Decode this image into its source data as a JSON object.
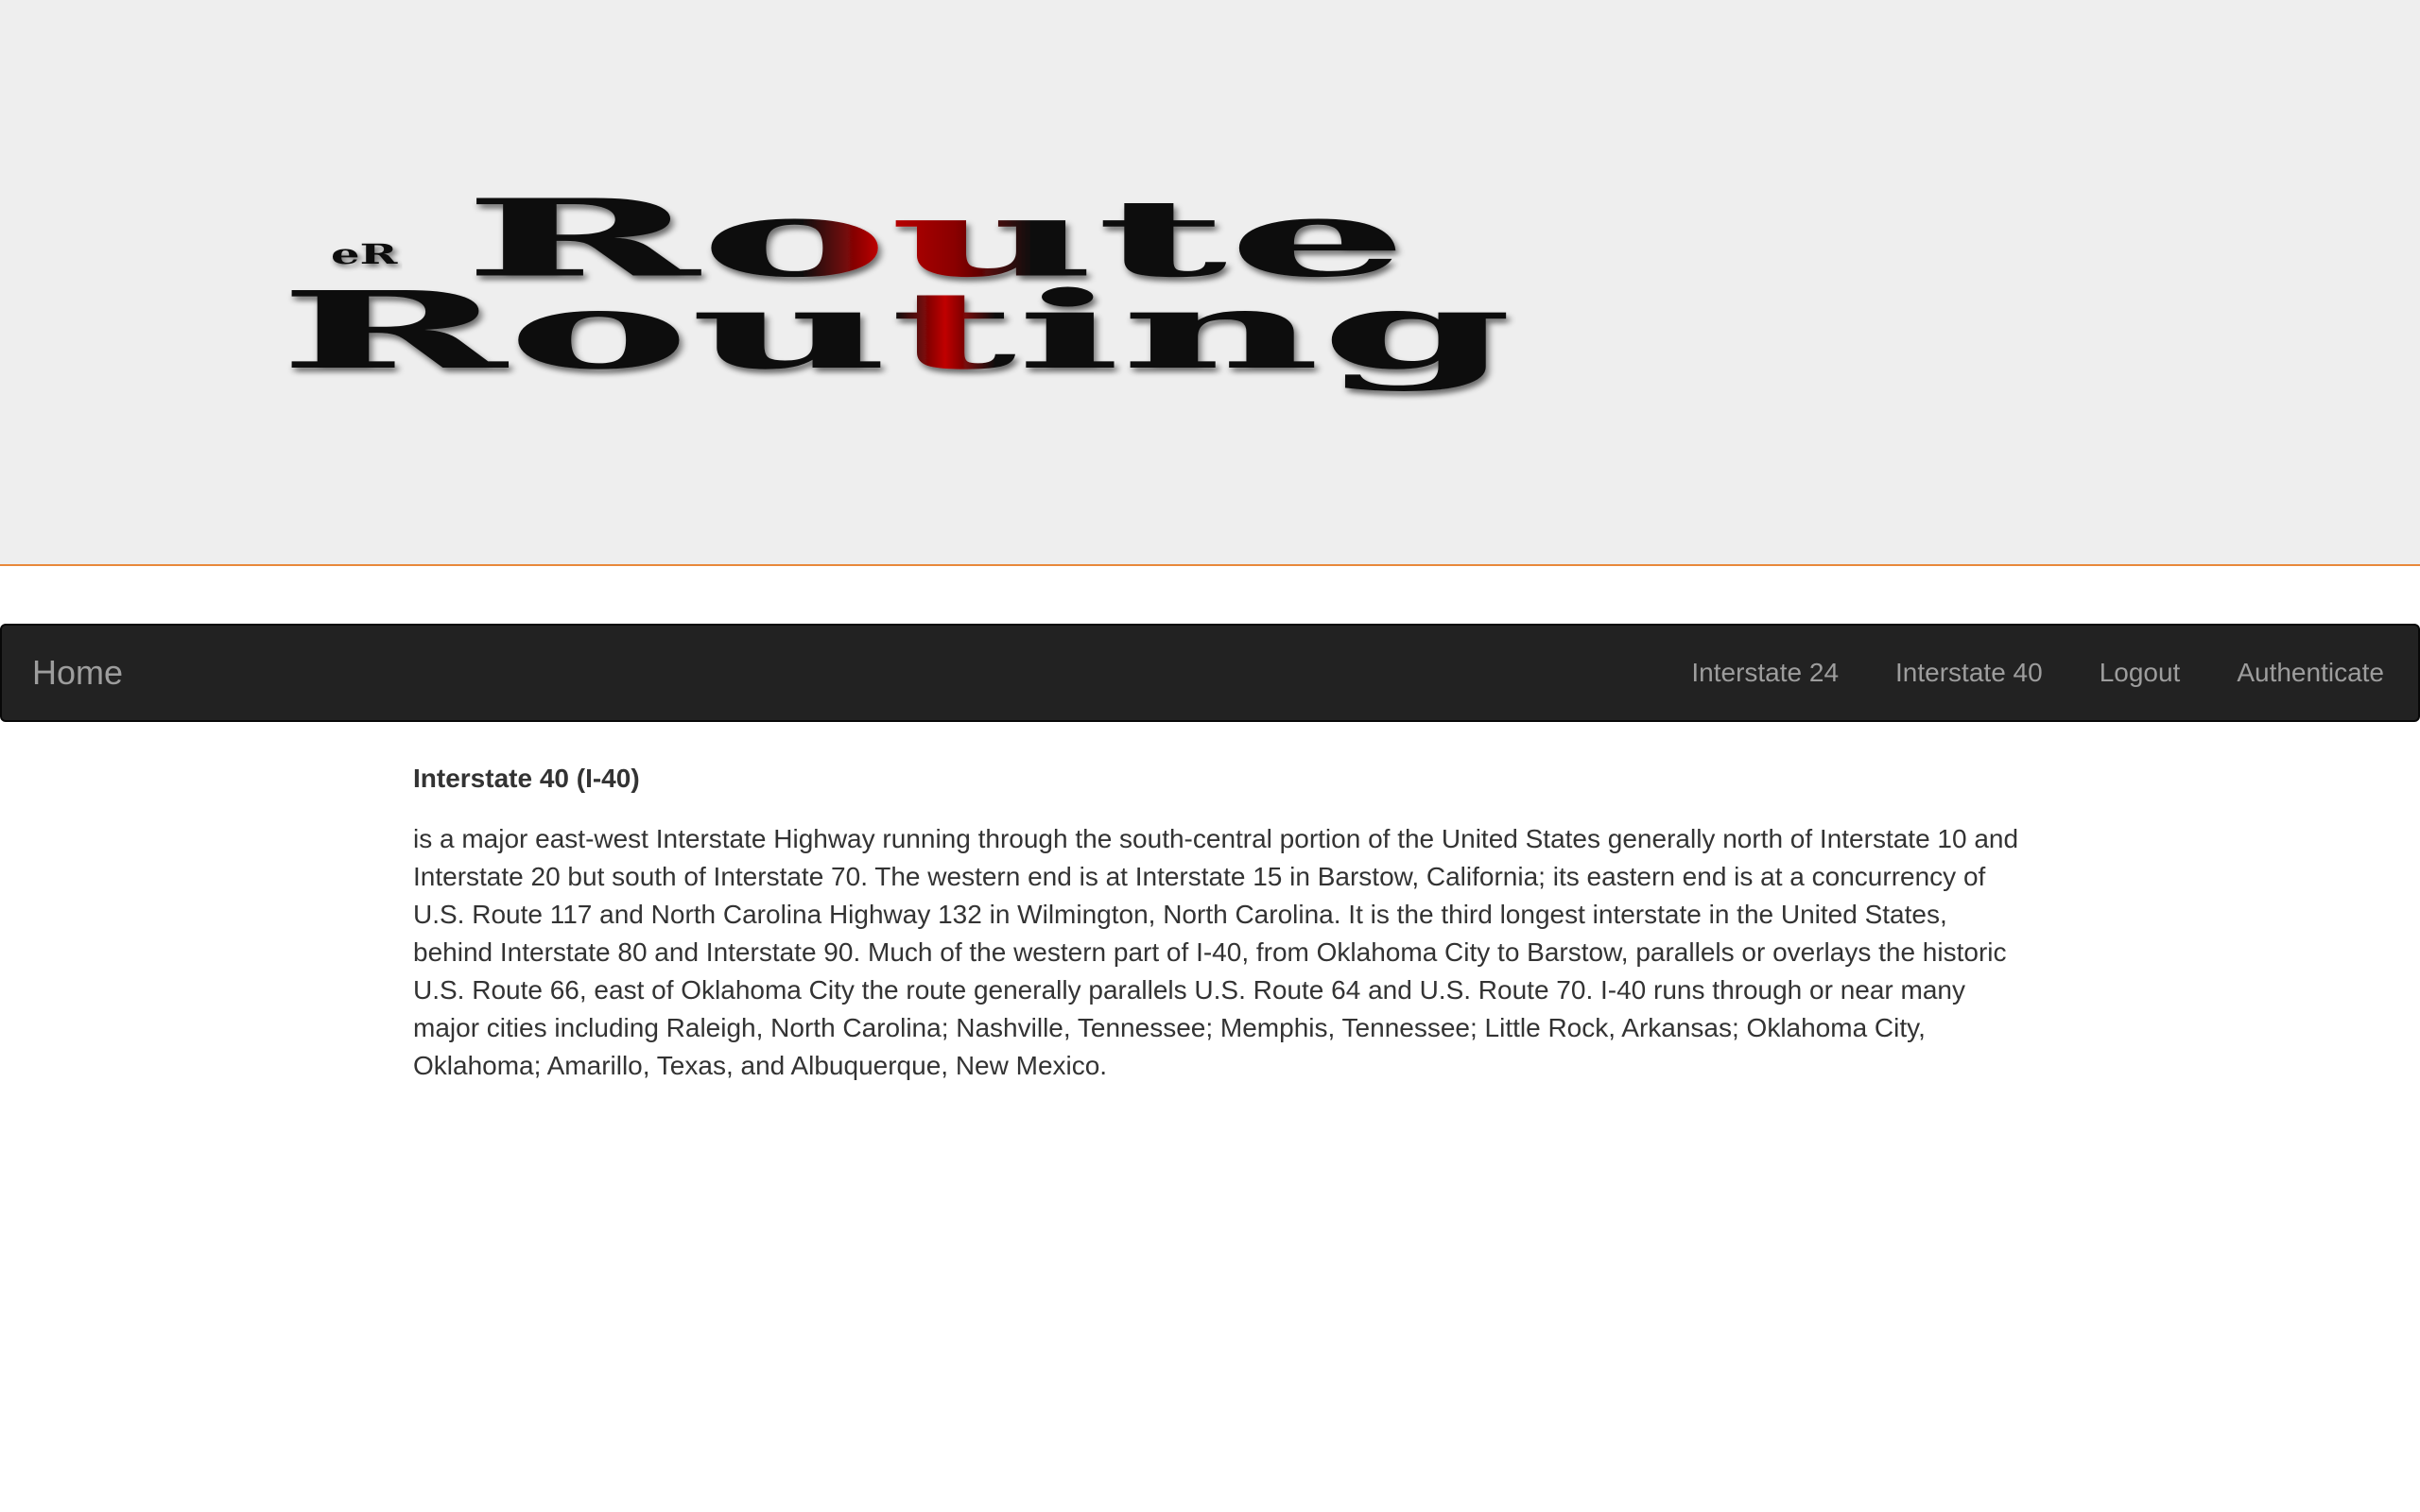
{
  "header": {
    "logo": {
      "small_mark": "eR",
      "line1": "Route",
      "line2": "Routing"
    }
  },
  "navbar": {
    "brand": "Home",
    "links": [
      {
        "label": "Interstate 24"
      },
      {
        "label": "Interstate 40"
      },
      {
        "label": "Logout"
      },
      {
        "label": "Authenticate"
      }
    ]
  },
  "article": {
    "title": "Interstate 40 (I-40)",
    "body": "is a major east-west Interstate Highway running through the south-central portion of the United States generally north of Interstate 10 and Interstate 20 but south of Interstate 70. The western end is at Interstate 15 in Barstow, California; its eastern end is at a concurrency of U.S. Route 117 and North Carolina Highway 132 in Wilmington, North Carolina. It is the third longest interstate in the United States, behind Interstate 80 and Interstate 90. Much of the western part of I-40, from Oklahoma City to Barstow, parallels or overlays the historic U.S. Route 66, east of Oklahoma City the route generally parallels U.S. Route 64 and U.S. Route 70. I-40 runs through or near many major cities including Raleigh, North Carolina; Nashville, Tennessee; Memphis, Tennessee; Little Rock, Arkansas; Oklahoma City, Oklahoma; Amarillo, Texas, and Albuquerque, New Mexico."
  },
  "colors": {
    "banner_bg": "#eeeeee",
    "banner_border": "#e8883a",
    "navbar_bg": "#222222",
    "nav_text": "#9d9d9d",
    "logo_black": "#111111",
    "logo_red": "#c00000"
  }
}
